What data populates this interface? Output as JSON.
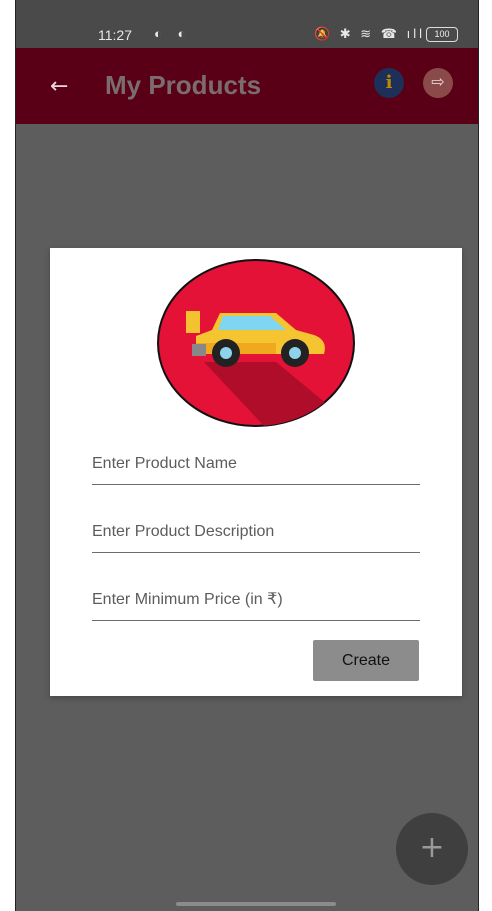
{
  "status_bar": {
    "time": "11:27",
    "left_icons": "◐ ◐",
    "right_icons": "🔕 ✱ ≋ ☎ ıll",
    "battery": "100"
  },
  "app_bar": {
    "title": "My Products",
    "back_icon": "←",
    "info_icon": "i",
    "logout_icon": "⇨",
    "colors": {
      "background": "#5a0016",
      "title": "#7b6d6f"
    }
  },
  "dialog": {
    "logo_icon": "car-logo",
    "fields": {
      "name_placeholder": "Enter Product Name",
      "description_placeholder": "Enter Product Description",
      "price_placeholder": "Enter Minimum Price (in ₹)"
    },
    "create_label": "Create"
  },
  "fab": {
    "label": "+"
  }
}
